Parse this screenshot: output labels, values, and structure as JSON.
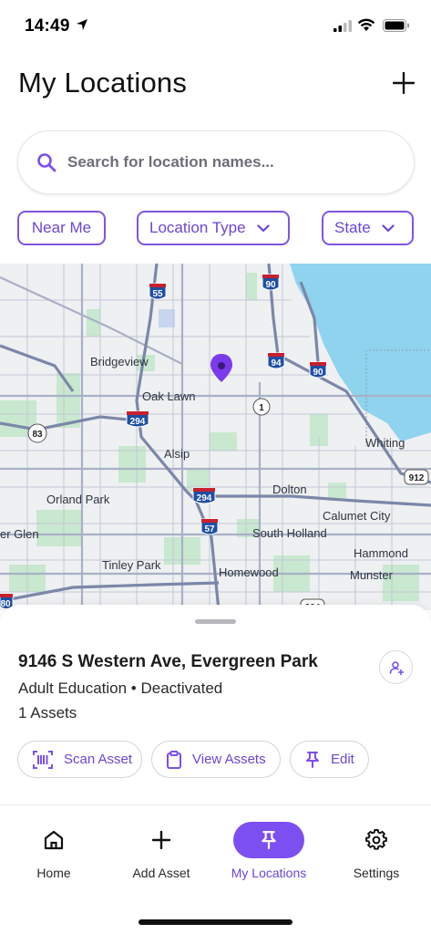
{
  "status_bar": {
    "time": "14:49"
  },
  "header": {
    "title": "My Locations",
    "add_icon": "plus-icon"
  },
  "search": {
    "placeholder": "Search for location names..."
  },
  "filters": [
    {
      "label": "Near Me",
      "has_dropdown": false
    },
    {
      "label": "Location Type",
      "has_dropdown": true
    },
    {
      "label": "State",
      "has_dropdown": true
    }
  ],
  "map": {
    "labels": [
      "Bridgeview",
      "Oak Lawn",
      "Alsip",
      "Orland Park",
      "Dolton",
      "Calumet City",
      "Whiting",
      "South Holland",
      "Hammond",
      "Tinley Park",
      "Homewood",
      "Munster",
      "er Glen"
    ],
    "shields": [
      "55",
      "90",
      "94",
      "90",
      "294",
      "1",
      "83",
      "294",
      "57",
      "912",
      "80",
      "394"
    ],
    "colors": {
      "land": "#eef0f2",
      "water": "#8fd3ee",
      "park": "#c8e8cf",
      "road": "#a9b0c6",
      "highway": "#7c87a8",
      "pin": "#7c3aed"
    }
  },
  "location_card": {
    "name": "9146 S Western Ave, Evergreen Park",
    "meta": "Adult Education • Deactivated",
    "assets": "1 Assets",
    "actions": [
      {
        "label": "Scan Asset",
        "icon": "barcode-scan-icon"
      },
      {
        "label": "View Assets",
        "icon": "clipboard-icon"
      },
      {
        "label": "Edit",
        "icon": "pin-icon"
      }
    ]
  },
  "nav": [
    {
      "label": "Home",
      "icon": "home-icon",
      "active": false
    },
    {
      "label": "Add Asset",
      "icon": "plus-icon",
      "active": false
    },
    {
      "label": "My Locations",
      "icon": "pin-icon",
      "active": true
    },
    {
      "label": "Settings",
      "icon": "gear-icon",
      "active": false
    }
  ],
  "accent_color": "#7c4ff0"
}
